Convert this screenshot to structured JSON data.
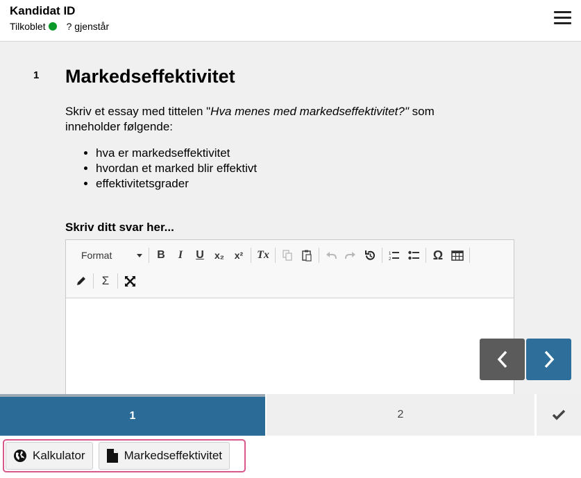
{
  "header": {
    "title": "Kandidat ID",
    "status_label": "Tilkoblet",
    "status_color": "#0a9a2a",
    "remaining": "? gjenstår",
    "menu_icon": "hamburger-icon"
  },
  "question": {
    "number": "1",
    "title": "Markedseffektivitet",
    "intro_prefix": "Skriv et essay med tittelen \"",
    "intro_title": "Hva menes med markedseffektivitet?\"",
    "intro_suffix": " som inneholder følgende:",
    "bullets": [
      "hva er markedseffektivitet",
      "hvordan et marked blir effektivt",
      "effektivitetsgrader"
    ],
    "answer_label": "Skriv ditt svar her..."
  },
  "editor": {
    "format_label": "Format",
    "toolbar_icons": [
      "bold-icon",
      "italic-icon",
      "underline-icon",
      "subscript-icon",
      "superscript-icon",
      "remove-format-icon",
      "copy-icon",
      "paste-icon",
      "undo-icon",
      "redo-icon",
      "history-icon",
      "numbered-list-icon",
      "bullet-list-icon",
      "special-char-icon",
      "table-icon",
      "pencil-icon",
      "sigma-icon",
      "fullscreen-icon"
    ],
    "bold": "B",
    "italic": "I",
    "underline": "U",
    "subscript": "x₂",
    "superscript": "x²",
    "remove_format": "Tx",
    "special_char": "Ω",
    "sigma": "Σ"
  },
  "tabs": {
    "tab1": "1",
    "tab2": "2",
    "active_color": "#2b6b98"
  },
  "resources": {
    "calculator": "Kalkulator",
    "document": "Markedseffektivitet",
    "border_color": "#d9578a"
  }
}
